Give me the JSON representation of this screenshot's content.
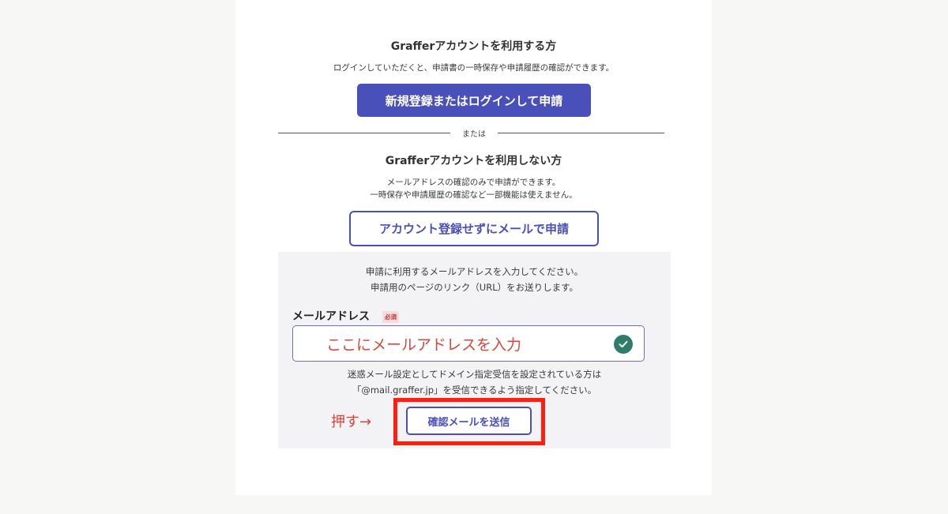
{
  "section_login": {
    "title": "Grafferアカウントを利用する方",
    "description": "ログインしていただくと、申請書の一時保存や申請履歴の確認ができます。",
    "button_label": "新規登録またはログインして申請"
  },
  "divider": {
    "label": "または"
  },
  "section_guest": {
    "title": "Grafferアカウントを利用しない方",
    "description_line1": "メールアドレスの確認のみで申請ができます。",
    "description_line2": "一時保存や申請履歴の確認など一部機能は使えません。",
    "button_label": "アカウント登録せずにメールで申請"
  },
  "email_panel": {
    "intro_line1": "申請に利用するメールアドレスを入力してください。",
    "intro_line2": "申請用のページのリンク（URL）をお送りします。",
    "field_label": "メールアドレス",
    "required_badge": "必須",
    "input_value": "ここにメールアドレスを入力",
    "note_line1": "迷惑メール設定としてドメイン指定受信を設定されている方は",
    "note_line2": "「@mail.graffer.jp」を受信できるよう指定してください。",
    "push_annotation": "押す→",
    "send_button_label": "確認メールを送信"
  },
  "colors": {
    "accent": "#4a50ba",
    "annotation_red": "#d9463c",
    "highlight_frame": "#ff1e10",
    "check_green": "#2e7d6a"
  },
  "icons": {
    "valid": "check-circle-icon"
  }
}
